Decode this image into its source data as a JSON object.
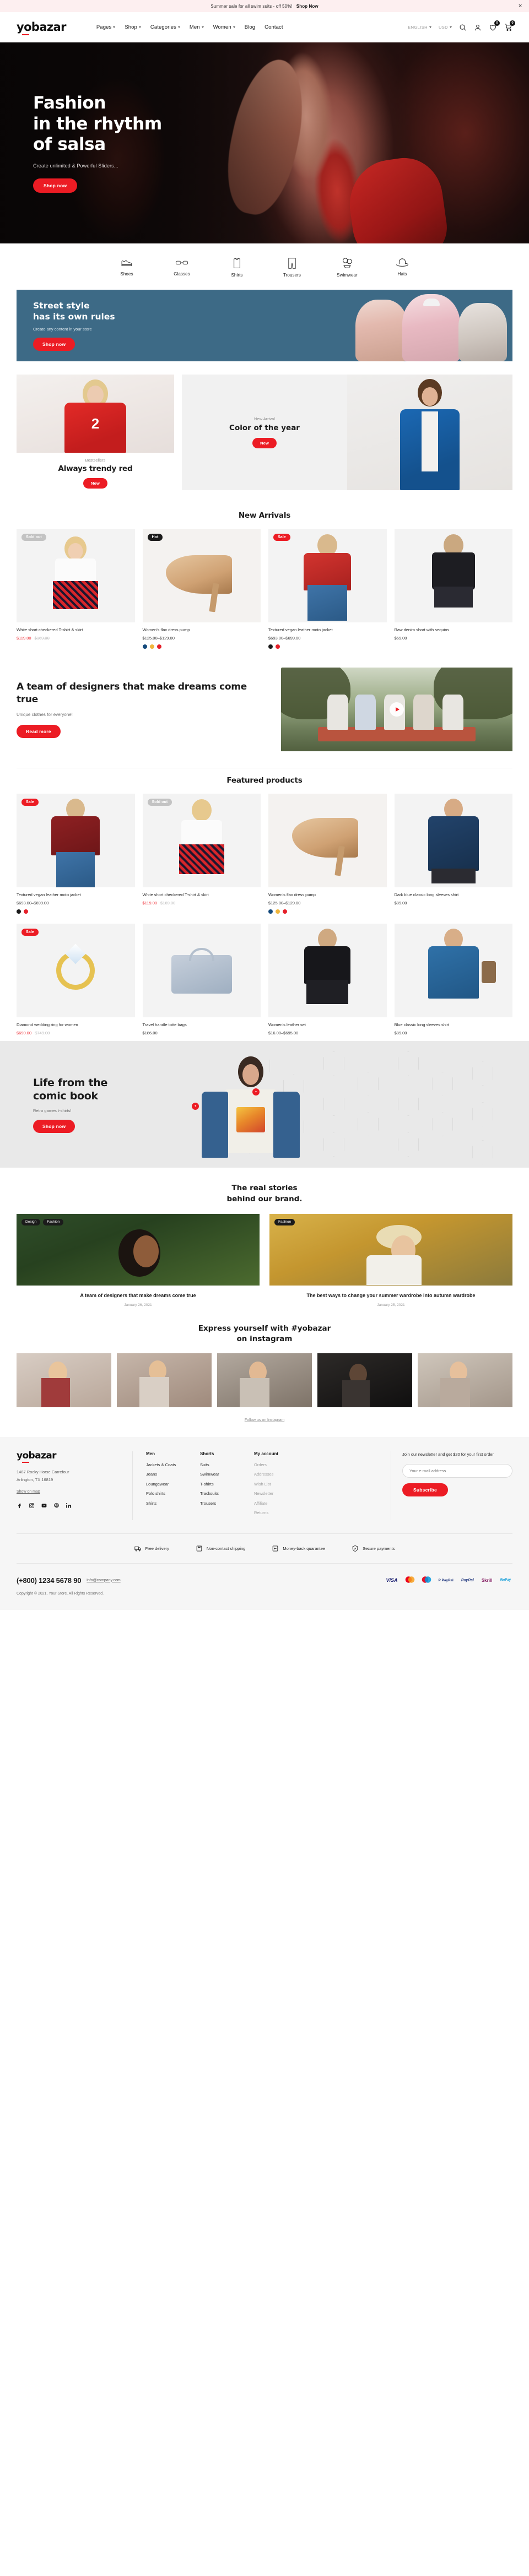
{
  "announce": {
    "text": "Summer sale for all swim suits - off 50%!",
    "cta": "Shop Now",
    "close": "✕"
  },
  "header": {
    "logo": "yobazar",
    "nav": [
      {
        "label": "Pages",
        "caret": true
      },
      {
        "label": "Shop",
        "caret": true
      },
      {
        "label": "Categories",
        "caret": true
      },
      {
        "label": "Men",
        "caret": true
      },
      {
        "label": "Women",
        "caret": true
      },
      {
        "label": "Blog",
        "caret": false
      },
      {
        "label": "Contact",
        "caret": false
      }
    ],
    "language": "ENGLISH",
    "currency": "USD",
    "search_icon": "search-icon",
    "account_icon": "user-icon",
    "wishlist_count": "0",
    "cart_count": "0"
  },
  "hero": {
    "line1": "Fashion",
    "line2": "in the rhythm",
    "line3": "of salsa",
    "subtitle": "Create unlimited & Powerful Sliders...",
    "cta": "Shop now"
  },
  "categories": [
    {
      "label": "Shoes",
      "icon": "shoe-icon"
    },
    {
      "label": "Glasses",
      "icon": "glasses-icon"
    },
    {
      "label": "Shirts",
      "icon": "shirt-icon"
    },
    {
      "label": "Trousers",
      "icon": "trousers-icon"
    },
    {
      "label": "Swimwear",
      "icon": "swimwear-icon"
    },
    {
      "label": "Hats",
      "icon": "hat-icon"
    }
  ],
  "street_banner": {
    "line1": "Street style",
    "line2": "has its own rules",
    "subtitle": "Create any content in your store",
    "cta": "Shop now",
    "bg_color": "#3d6a86"
  },
  "promo_left": {
    "kicker": "Bestsellers",
    "title": "Always trendy red",
    "cta": "New"
  },
  "promo_right": {
    "kicker": "New Arrival",
    "title": "Color of the year",
    "cta": "New"
  },
  "new_arrivals": {
    "title": "New Arrivals",
    "products": [
      {
        "name": "White short checkered T-shirt & skirt",
        "price_now": "$119.00",
        "price_was": "$169.00",
        "badge": "Sold out",
        "badge_type": "sold",
        "swatches": []
      },
      {
        "name": "Women's flax dress pump",
        "price_now": "$125.00–$129.00",
        "price_was": "",
        "badge": "Hot",
        "badge_type": "hot",
        "swatches": [
          "#144a7c",
          "#f0b63c",
          "#e5202a"
        ]
      },
      {
        "name": "Textured vegan leather moto jacket",
        "price_now": "$693.00–$699.00",
        "price_was": "",
        "badge": "Sale",
        "badge_type": "sale",
        "swatches": [
          "#1b1b1b",
          "#e5202a"
        ]
      },
      {
        "name": "Raw denim short with sequins",
        "price_now": "$69.00",
        "price_was": "",
        "badge": "",
        "badge_type": "",
        "swatches": []
      }
    ]
  },
  "designers": {
    "title": "A team of designers that make dreams come true",
    "subtitle": "Unique clothes for everyone!",
    "cta": "Read more",
    "play_icon": "play-icon"
  },
  "featured": {
    "title": "Featured products",
    "products": [
      {
        "name": "Textured vegan leather moto jacket",
        "price_now": "$693.00–$699.00",
        "price_was": "",
        "badge": "Sale",
        "badge_type": "sale",
        "swatches": [
          "#1b1b1b",
          "#e5202a"
        ]
      },
      {
        "name": "White short checkered T-shirt & skirt",
        "price_now": "$119.00",
        "price_was": "$169.00",
        "badge": "Sold out",
        "badge_type": "sold",
        "swatches": []
      },
      {
        "name": "Women's flax dress pump",
        "price_now": "$125.00–$129.00",
        "price_was": "",
        "badge": "",
        "badge_type": "",
        "swatches": [
          "#144a7c",
          "#f0b63c",
          "#e5202a"
        ]
      },
      {
        "name": "Dark blue classic long sleeves shirt",
        "price_now": "$89.00",
        "price_was": "",
        "badge": "",
        "badge_type": "",
        "swatches": []
      },
      {
        "name": "Diamond wedding ring for women",
        "price_now": "$690.00",
        "price_was": "$749.00",
        "badge": "Sale",
        "badge_type": "sale",
        "swatches": []
      },
      {
        "name": "Travel handle totte bags",
        "price_now": "$186.00",
        "price_was": "",
        "badge": "",
        "badge_type": "",
        "swatches": []
      },
      {
        "name": "Women's leather set",
        "price_now": "$16.00–$695.00",
        "price_was": "",
        "badge": "",
        "badge_type": "",
        "swatches": []
      },
      {
        "name": "Blue classic long sleeves shirt",
        "price_now": "$89.00",
        "price_was": "",
        "badge": "",
        "badge_type": "",
        "swatches": []
      }
    ]
  },
  "comic": {
    "line1": "Life from the",
    "line2": "comic book",
    "subtitle": "Retro games t-shirts!",
    "cta": "Shop now",
    "hotspot_1": "+",
    "hotspot_2": "+"
  },
  "blog": {
    "title_line1": "The real stories",
    "title_line2": "behind our brand.",
    "posts": [
      {
        "tags": [
          "Design",
          "Fashion"
        ],
        "title": "A team of designers that make dreams come true",
        "date": "January 26, 2021"
      },
      {
        "tags": [
          "Fashion"
        ],
        "title": "The best ways to change your summer wardrobe into autumn wardrobe",
        "date": "January 25, 2021"
      }
    ]
  },
  "instagram": {
    "title_line1": "Express yourself with #yobazar",
    "title_line2": "on instagram",
    "follow": "Follow us on Instagram"
  },
  "footer": {
    "logo": "yobazar",
    "address_line1": "1487 Rocky Horse Carrefour",
    "address_line2": "Arlington, TX 16819",
    "map_link": "Show on map",
    "socials": [
      "facebook-icon",
      "instagram-icon",
      "youtube-icon",
      "pinterest-icon",
      "linkedin-icon"
    ],
    "columns": [
      {
        "heading": "Men",
        "links": [
          "Jackets & Coats",
          "Jeans",
          "Loungewear",
          "Polo shirts",
          "Shirts"
        ]
      },
      {
        "heading": "Shorts",
        "links": [
          "Suits",
          "Swimwear",
          "T-shirts",
          "Tracksuits",
          "Trousers"
        ]
      },
      {
        "heading": "My account",
        "links": [
          "Orders",
          "Addresses",
          "Wish List",
          "Newsletter",
          "Affiliate",
          "Returns"
        ],
        "muted": true
      }
    ],
    "newsletter": {
      "text": "Join our newsletter and get $20 for your first order",
      "placeholder": "Your e-mail address",
      "button": "Subscribe"
    },
    "trust": [
      {
        "label": "Free delivery",
        "icon": "truck-icon"
      },
      {
        "label": "Non-contact shipping",
        "icon": "box-icon"
      },
      {
        "label": "Money-back quarantee",
        "icon": "refund-icon"
      },
      {
        "label": "Secure payments",
        "icon": "shield-icon"
      }
    ],
    "phone": "(+800) 1234 5678 90",
    "email": "info@company.com",
    "copyright": "Copyright © 2021, Your Store. All Rights Reserved.",
    "payments": [
      "VISA",
      "MasterCard",
      "Maestro",
      "P PayPal",
      "PayPal",
      "Skrill",
      "WePay"
    ]
  }
}
